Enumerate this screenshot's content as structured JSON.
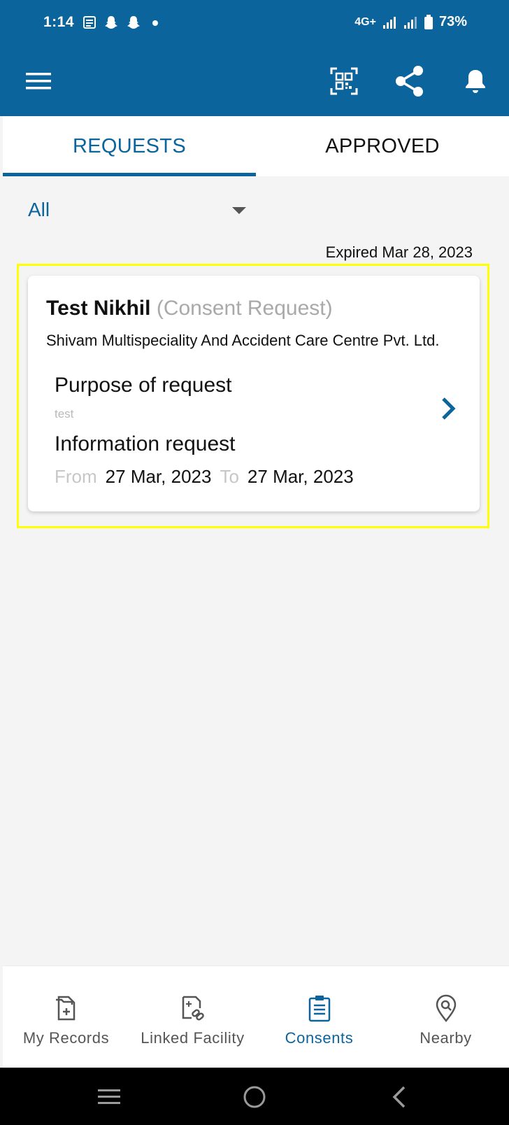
{
  "status_bar": {
    "time": "1:14",
    "network": "4G+",
    "battery": "73%"
  },
  "app_bar": {
    "icons": [
      "menu-icon",
      "qr-code-icon",
      "share-icon",
      "bell-icon"
    ]
  },
  "tabs": [
    {
      "label": "REQUESTS",
      "active": true
    },
    {
      "label": "APPROVED",
      "active": false
    }
  ],
  "filter": {
    "selected": "All"
  },
  "requests": [
    {
      "expired_text": "Expired Mar 28, 2023",
      "name": "Test Nikhil",
      "type": "(Consent Request)",
      "facility": "Shivam Multispeciality And Accident Care Centre Pvt. Ltd.",
      "purpose_label": "Purpose of request",
      "purpose_value": "test",
      "info_label": "Information request",
      "from_label": "From",
      "from_date": "27 Mar, 2023",
      "to_label": "To",
      "to_date": "27 Mar, 2023"
    }
  ],
  "bottom_nav": [
    {
      "label": "My Records",
      "icon": "records-icon",
      "active": false
    },
    {
      "label": "Linked Facility",
      "icon": "linked-facility-icon",
      "active": false
    },
    {
      "label": "Consents",
      "icon": "consents-icon",
      "active": true
    },
    {
      "label": "Nearby",
      "icon": "nearby-icon",
      "active": false
    }
  ],
  "colors": {
    "primary": "#0b649c",
    "highlight": "#ffff00",
    "background": "#f4f4f4",
    "muted": "#a9a9a9"
  }
}
